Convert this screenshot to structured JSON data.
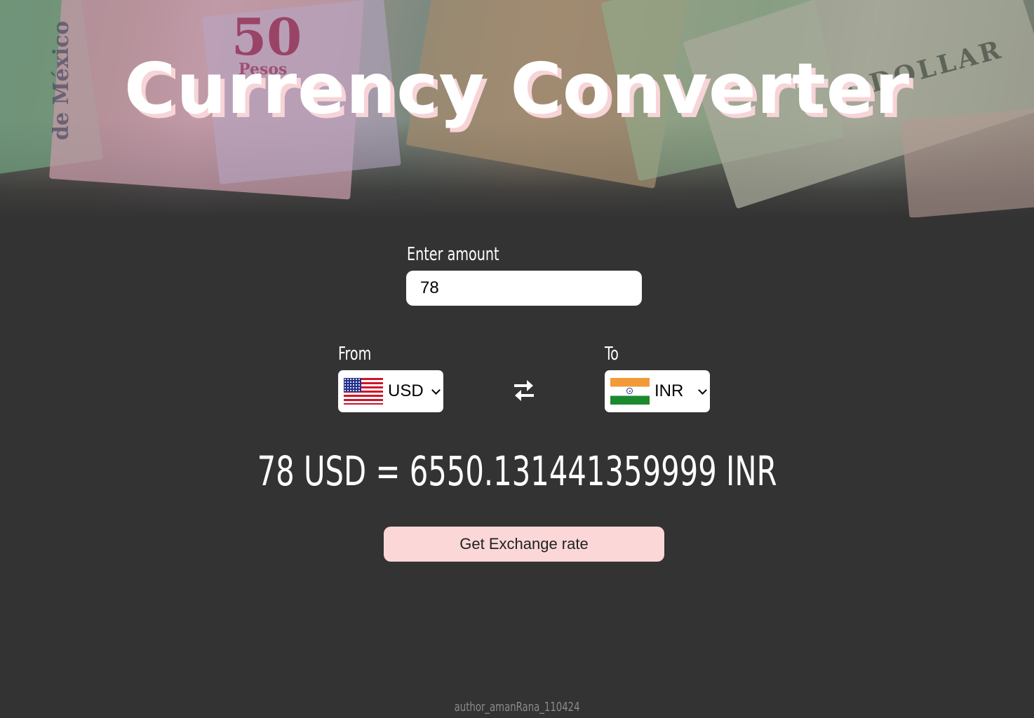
{
  "header": {
    "title": "Currency Converter",
    "background_colors": {
      "title_text": "#ffffff",
      "title_shadow": "#f7d4d7"
    }
  },
  "converter": {
    "amount_label": "Enter amount",
    "amount_value": "78",
    "from_label": "From",
    "from_currency": "USD",
    "from_flag": "us-flag-icon",
    "swap_icon": "swap-arrows-icon",
    "to_label": "To",
    "to_currency": "INR",
    "to_flag": "india-flag-icon",
    "result_text": "78 USD = 6550.131441359999 INR",
    "button_label": "Get Exchange rate"
  },
  "footer": {
    "author": "author_amanRana_110424"
  },
  "colors": {
    "page_background": "#333333",
    "button_background": "#fbd7d8",
    "text": "#ffffff"
  }
}
